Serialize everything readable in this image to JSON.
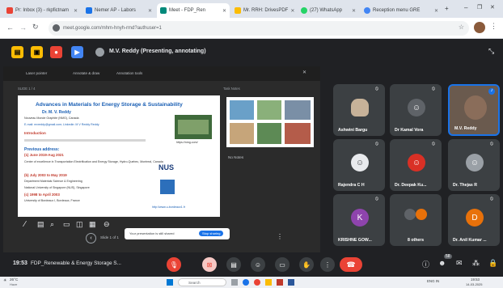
{
  "browser": {
    "tabs": [
      {
        "label": "Pr: Inbox (3) - rkpfictnam"
      },
      {
        "label": "Nemer AP - Labors"
      },
      {
        "label": "Meet - FDP_Ren"
      },
      {
        "label": "Mr. RRH: DrivesPDF"
      },
      {
        "label": "(27) WhatsApp"
      },
      {
        "label": "Reception menu GRE"
      }
    ],
    "url": "meet.google.com/mhm-hnyh-rmd?authuser=1"
  },
  "meet": {
    "presenter_label": "M.V. Reddy (Presenting, annotating)",
    "share_toolbar": [
      "Laser pointer",
      "Annotate & draw",
      "Annotation tools"
    ],
    "slide_panel_label": "SLIDE 1 / 4",
    "notes_label": "Task Notes",
    "no_notes": "No Notes",
    "slide": {
      "title": "Advances in Materials for Energy Storage & Sustainability",
      "presenter": "Dr. M. V. Reddy",
      "subtitle_line": "Nouveau Monde Graphite (NMG), Canada",
      "email_line": "E-mail: mvreddy@gmail.com; Linkedin: M V Reddy Reddy",
      "url": "https://nmg.com/",
      "intro_header": "Introduction",
      "prev_header": "Previous address:",
      "periods": [
        "(1) June 2019-Aug 2021",
        "(b) July 2003 to May 2019",
        "(c) 1998 to April 2003"
      ],
      "orgs": [
        "Center of excellence in Transportation Electrification and Energy Storage, Hydro-Quebec, Montreal, Canada",
        "Department Materials Science & Engineering",
        "National University of Singapore (NUS), Singapore",
        "University of Bordeaux I, Bordeaux, France"
      ],
      "nus_logo_text": "NUS",
      "bottom_url": "http://www.u-bordeaux1.fr"
    },
    "page_controls": {
      "slide_label": "Slide 1 of 1"
    },
    "keep_sharing": {
      "text": "Your presentation is still shared",
      "button": "Stop sharing"
    },
    "participants": [
      {
        "name": "Ashwini Bargu",
        "type": "photo",
        "color": "#c7b299"
      },
      {
        "name": "Dr Kamal Vora",
        "type": "avatar",
        "color": "#5f6368"
      },
      {
        "name": "M.V. Reddy",
        "type": "photo",
        "color": "#8a6d5a"
      },
      {
        "name": "Rajendra C H",
        "type": "avatar",
        "color": "#e8eaed"
      },
      {
        "name": "Dr. Deepak Ku...",
        "type": "avatar",
        "color": "#d93025"
      },
      {
        "name": "Dr. Thejas R",
        "type": "avatar",
        "color": "#9aa0a6"
      },
      {
        "name": "KRISHNE GOW...",
        "type": "letter",
        "letter": "K",
        "color": "#8e44ad"
      },
      {
        "name": "8 others",
        "type": "group",
        "color": "#5f6368"
      },
      {
        "name": "Dr. Anil Kumar ...",
        "type": "letter",
        "letter": "D",
        "color": "#e8710a"
      }
    ],
    "time": "19:53",
    "meeting_name": "FDP_Renewable & Energy Storage S...",
    "participant_count": "58"
  },
  "taskbar": {
    "weather": "26°C",
    "weather_desc": "Haze",
    "search_placeholder": "Search",
    "lang": "ENG IN",
    "clock": "19:53",
    "date": "14-03-2025"
  },
  "colors": {
    "meet_bg": "#202124",
    "tile_bg": "#3c4043",
    "hangup": "#ea4335",
    "accent_blue": "#1a73e8",
    "slide_title": "#1a5fb4",
    "slide_red": "#c0392b"
  }
}
